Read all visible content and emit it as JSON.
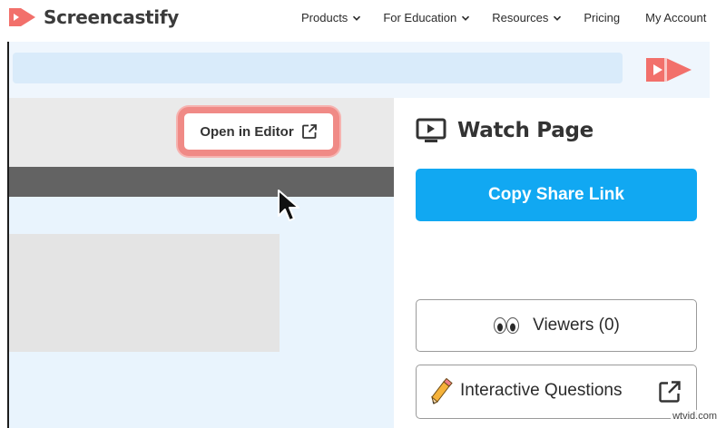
{
  "nav": {
    "brand": "Screencastify",
    "links": {
      "products": "Products",
      "education": "For Education",
      "resources": "Resources",
      "pricing": "Pricing",
      "account": "My Account"
    }
  },
  "editor": {
    "open_in_editor_label": "Open in Editor"
  },
  "watch_panel": {
    "title": "Watch Page",
    "copy_share_link_label": "Copy Share Link",
    "viewers_label": "Viewers (0)",
    "interactive_questions_label": "Interactive Questions"
  },
  "watermark": "wtvid.com",
  "colors": {
    "brand_red": "#f2706b",
    "highlight_border": "#f08a86",
    "primary_blue": "#11a8f2",
    "dark_bar": "#636363"
  },
  "icons": {
    "brand": "screencastify-logo",
    "chevron": "chevron-down-icon",
    "open_external": "external-link-icon",
    "cursor": "mouse-pointer-icon",
    "watch": "monitor-play-icon",
    "viewers": "eyes-icon",
    "questions": "pencil-icon"
  }
}
